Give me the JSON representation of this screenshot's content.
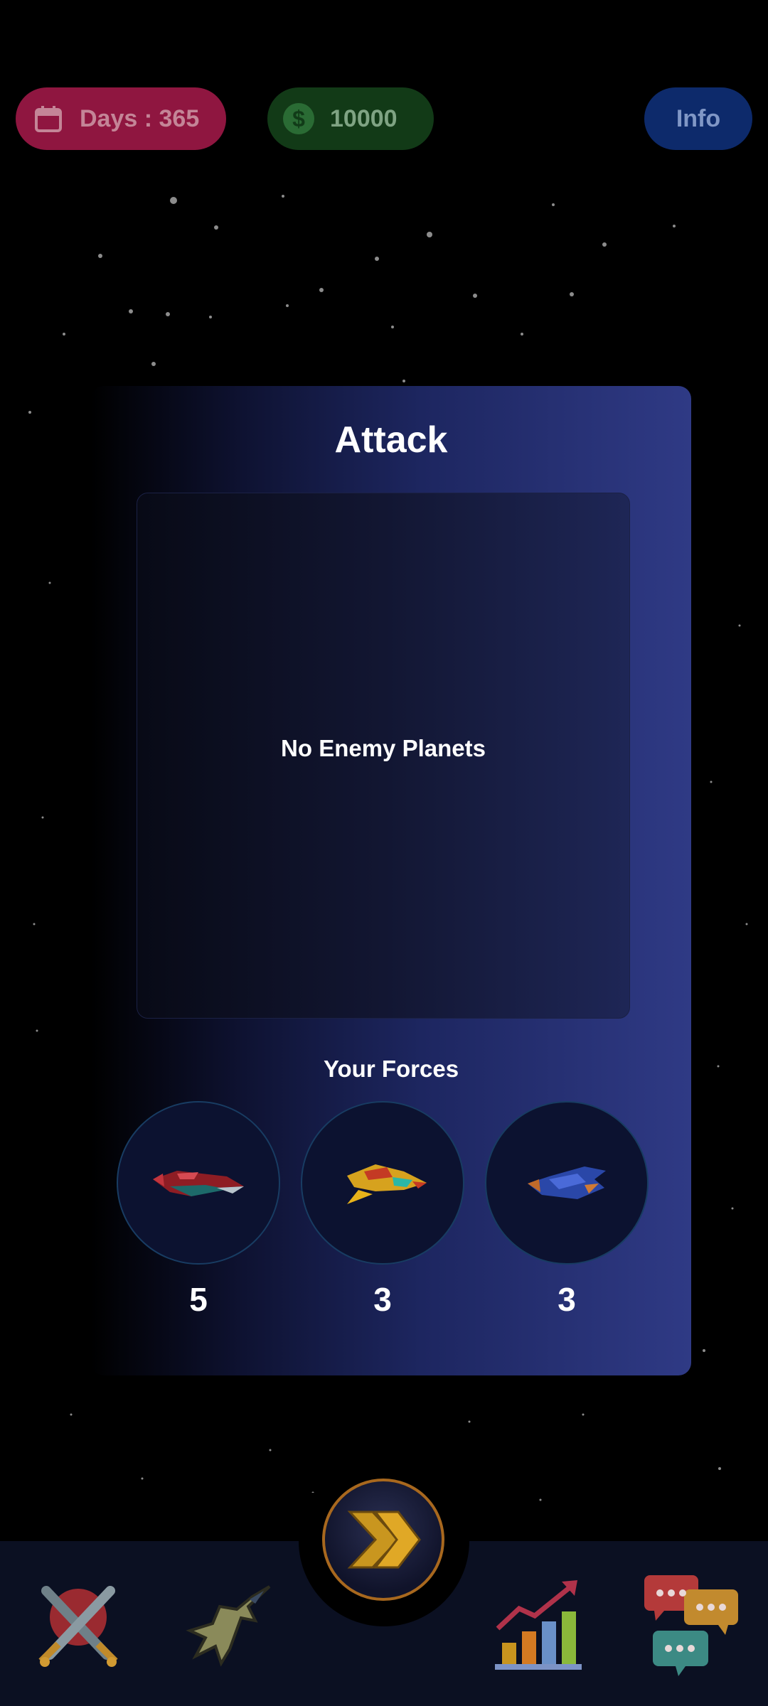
{
  "hud": {
    "days_label": "Days : 365",
    "money_value": "10000",
    "money_symbol": "$",
    "info_label": "Info",
    "days_icon": "calendar-icon",
    "money_icon": "dollar-coin-icon"
  },
  "attack_panel": {
    "title": "Attack",
    "enemy_empty_text": "No Enemy Planets",
    "forces_title": "Your Forces",
    "forces": [
      {
        "ship": "red-fighter-ship-icon",
        "count": "5"
      },
      {
        "ship": "yellow-cruiser-ship-icon",
        "count": "3"
      },
      {
        "ship": "blue-interceptor-ship-icon",
        "count": "3"
      }
    ]
  },
  "bottom_nav": {
    "items": [
      {
        "icon": "crossed-swords-icon"
      },
      {
        "icon": "fighter-jet-icon"
      },
      {
        "icon": "next-turn-chevron-icon"
      },
      {
        "icon": "stats-chart-icon"
      },
      {
        "icon": "chat-bubbles-icon"
      }
    ]
  },
  "colors": {
    "days_pill": "#8f1640",
    "money_pill": "#123a17",
    "info_pill": "#0d2a6b",
    "panel_accent": "#2f3a85",
    "next_button_ring": "#a8681e"
  }
}
